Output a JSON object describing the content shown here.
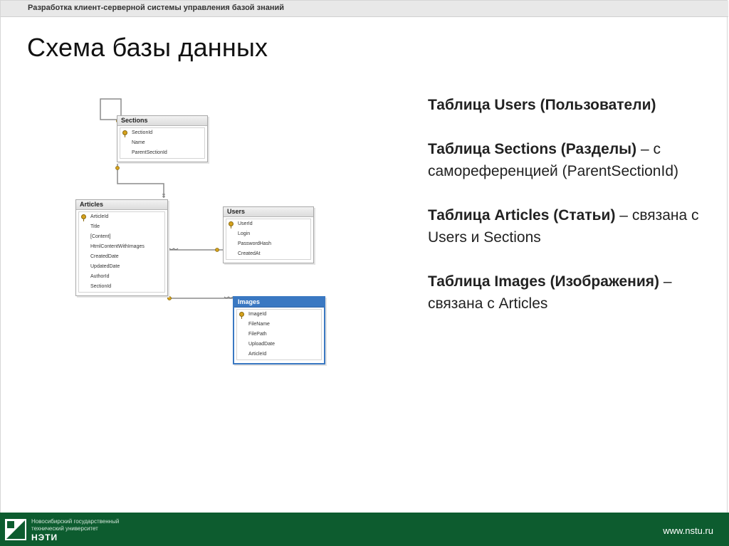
{
  "header": {
    "course_title": "Разработка клиент-серверной системы управления базой знаний"
  },
  "page_title": "Схема базы данных",
  "diagram": {
    "tables": [
      {
        "name": "Sections",
        "columns": [
          "SectionId",
          "Name",
          "ParentSectionId"
        ],
        "primary_key": "SectionId"
      },
      {
        "name": "Articles",
        "columns": [
          "ArticleId",
          "Title",
          "[Content]",
          "HtmlContentWithImages",
          "CreatedDate",
          "UpdatedDate",
          "AuthorId",
          "SectionId"
        ],
        "primary_key": "ArticleId"
      },
      {
        "name": "Users",
        "columns": [
          "UserId",
          "Login",
          "PasswordHash",
          "CreatedAt"
        ],
        "primary_key": "UserId"
      },
      {
        "name": "Images",
        "columns": [
          "ImageId",
          "FileName",
          "FilePath",
          "UploadDate",
          "ArticleId"
        ],
        "primary_key": "ImageId",
        "selected": true
      }
    ],
    "relationships": [
      {
        "from": "Sections",
        "to": "Sections"
      },
      {
        "from": "Sections",
        "to": "Articles"
      },
      {
        "from": "Users",
        "to": "Articles"
      },
      {
        "from": "Articles",
        "to": "Images"
      }
    ]
  },
  "description": [
    {
      "bold": "Таблица Users (Пользователи)",
      "rest": ""
    },
    {
      "bold": "Таблица Sections (Разделы)",
      "rest": " – с самореференцией (ParentSectionId)"
    },
    {
      "bold": "Таблица Articles (Статьи)",
      "rest": " – связана с Users и Sections"
    },
    {
      "bold": "Таблица Images (Изображения)",
      "rest": " – связана с Articles"
    }
  ],
  "footer": {
    "university_line1": "Новосибирский государственный",
    "university_line2": "технический университет",
    "university_abbr": "НЭТИ",
    "website": "www.nstu.ru"
  },
  "colors": {
    "footer_bg": "#0d5c2f",
    "selected_table": "#3a78c2",
    "key_icon": "#d6a21c"
  }
}
